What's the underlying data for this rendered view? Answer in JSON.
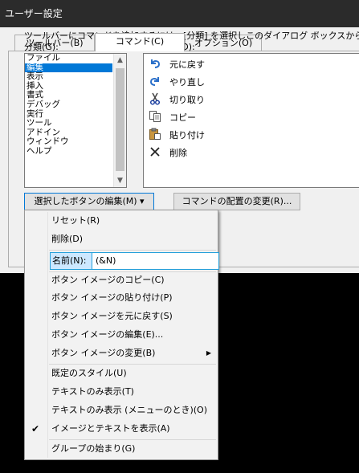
{
  "window": {
    "title": "ユーザー設定"
  },
  "tabs": [
    {
      "label": "ツールバー(B)"
    },
    {
      "label": "コマンド(C)"
    },
    {
      "label": "オプション(O)"
    }
  ],
  "instruction": "ツールバーにコマンドを追加するには、[分類] を選択しこのダイアログ ボックスからツール バーへ",
  "categories_label": "分類(G):",
  "commands_label": "コマンド(D):",
  "categories": [
    "ファイル",
    "編集",
    "表示",
    "挿入",
    "書式",
    "デバッグ",
    "実行",
    "ツール",
    "アドイン",
    "ウィンドウ",
    "ヘルプ"
  ],
  "selected_category": "編集",
  "commands": [
    {
      "label": "元に戻す",
      "icon": "undo-icon"
    },
    {
      "label": "やり直し",
      "icon": "redo-icon"
    },
    {
      "label": "切り取り",
      "icon": "scissors-icon"
    },
    {
      "label": "コピー",
      "icon": "copy-icon"
    },
    {
      "label": "貼り付け",
      "icon": "paste-icon"
    },
    {
      "label": "削除",
      "icon": "delete-x-icon"
    }
  ],
  "buttons": {
    "modify_selection": "選択したボタンの編集(M) ▾",
    "rearrange": "コマンドの配置の変更(R)..."
  },
  "menu": {
    "reset": "リセット(R)",
    "delete": "削除(D)",
    "name_label": "名前(N):",
    "name_value": "(&N)",
    "copy_image": "ボタン イメージのコピー(C)",
    "paste_image": "ボタン イメージの貼り付け(P)",
    "reset_image": "ボタン イメージを元に戻す(S)",
    "edit_image": "ボタン イメージの編集(E)...",
    "change_image": "ボタン イメージの変更(B)",
    "default_style": "既定のスタイル(U)",
    "text_only_always": "テキストのみ表示(T)",
    "text_only_menus": "テキストのみ表示 (メニューのとき)(O)",
    "image_and_text": "イメージとテキストを表示(A)",
    "begin_group": "グループの始まり(G)",
    "checked_item": "イメージとテキストを表示(A)"
  }
}
